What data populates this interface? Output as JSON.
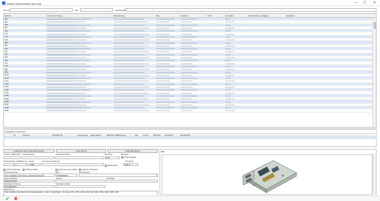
{
  "window": {
    "title": "Artikel übernehmen aus Exp",
    "controls": {
      "minimize": "—",
      "maximize": "☐",
      "close": "✕"
    }
  },
  "filter": {
    "label1": "Exp-Id",
    "label2": "Suel",
    "label3": "Suchbegriff"
  },
  "grid": {
    "columns": [
      "EXP-ID",
      "Kurzbezeichnung",
      "Bezeichnung",
      "Ean",
      "Garantie",
      "SVP",
      "Hersteller",
      "Web-Attribute verfügbar",
      "Einstell.dt."
    ],
    "row_ids": [
      "961",
      "963",
      "885",
      "861",
      "463",
      "470",
      "472",
      "478",
      "880",
      "893",
      "904",
      "927",
      "941",
      "964",
      "969",
      "971",
      "975",
      "980",
      "981",
      "1030",
      "1100",
      "1210",
      "1410",
      "1461",
      "1482",
      "1566",
      "1801",
      "1800",
      "1803",
      "1802",
      "1852",
      "1862"
    ]
  },
  "lieferanten": {
    "title": "Verfügbare Lieferanten:",
    "columns": [
      "Nr",
      "Lieferant",
      "Verfügbar ab",
      "Lagermenge",
      "Lager-Status",
      "Mehrfach Staffelmenge",
      "Neu",
      "Promo",
      "EK-Preis",
      "Einstell.dt.",
      "Einstell.Diff."
    ]
  },
  "buttons": {
    "uebernehmen": "Artikel aus obere Liste übernehmen",
    "copy": "Copy Picture",
    "datenblatt": "Datenblatt öffnen"
  },
  "form": {
    "kurzbezeichnung_label": "Kurzbez. Artikel EXP",
    "lieferanten_artnr_label": "Lieferanten-Nr.",
    "lieferanten_name_label": "Lieferanten-Name",
    "ek_preis_label": "EK Preis",
    "ek_netto_label": "EK Netto",
    "ek_value": "0,00",
    "brutto_label": "Brutto-Eingabe",
    "mindestmenge_label": "Mindestmenge",
    "staffelmenge_label": "Staffelmenge",
    "lager_label": "Lag-Id",
    "lieferanten_artnr2_label": "Lieferanten-Artikel-Nr",
    "mindestmenge_value": "1",
    "staffel_value": "1",
    "lager_value": "1490",
    "rohertrag_label": "Rohertrag",
    "rohertrag_value": "0,00 %",
    "rabatt_label": "Rabatt fähig",
    "lotto_label": "Lotto-Auszahlung",
    "inaktiv_label": "Inaktiver Artikel",
    "seriennummer_label": "Seriennummern-Artikel",
    "garantie_label": "Garantie verhanden",
    "kurzbez_artikel_label": "Kurzbezeichnung",
    "ean_label": "EAN",
    "warengruppe_label": "Warengruppe",
    "kurzbez_value": "Cisco Interface Card Serial - Einsteckungsmodul",
    "ean_value": "07462229019",
    "steuer_label": "Steuer-Schlüssel",
    "lagerort_label": "Lagerort",
    "rueckfrage_label": "Rückfrage",
    "steuer_value": "MWSt Deutschl",
    "kalk_label": "Kalkulations-Schema",
    "kalk_ident_label": "Kalkulations-Ident",
    "kalk_value": "PP-Kalkulation",
    "bezeichnung_label": "Bezeichnung",
    "bezeichnung_value": "Cisco Interface Card Serial - Einsteckungsmodul - seriell - 2 Anschlüsse - für Cisco 1721, 1751, 1760, 2610, 2611, 2621, 2651, 2691, 3725, 3745"
  },
  "bild": {
    "title": "Bild",
    "image_name": "cisco-interface-card-icon"
  },
  "footer": {
    "ok": "✔",
    "cancel": "✖"
  },
  "colors": {
    "selected_row": "#dce9f8",
    "ok_green": "#2e9e3a",
    "cancel_red": "#d23b2b"
  }
}
